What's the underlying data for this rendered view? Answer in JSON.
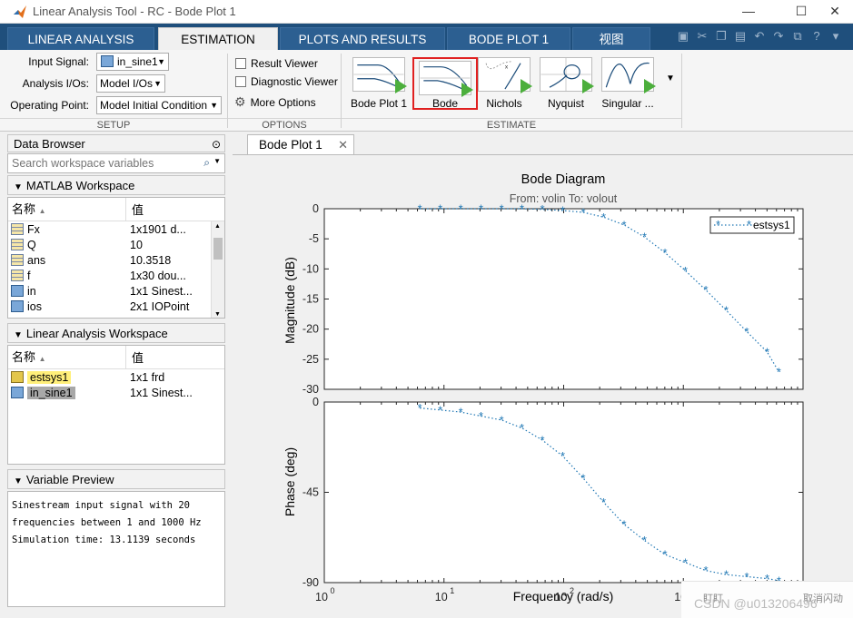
{
  "window": {
    "title": "Linear Analysis Tool - RC - Bode Plot 1"
  },
  "ribbon_tabs": [
    "LINEAR ANALYSIS",
    "ESTIMATION",
    "PLOTS AND RESULTS",
    "BODE PLOT 1",
    "视图"
  ],
  "setup": {
    "input_signal_label": "Input Signal:",
    "input_signal_value": "in_sine1",
    "analysis_ios_label": "Analysis I/Os:",
    "analysis_ios_value": "Model I/Os",
    "operating_point_label": "Operating Point:",
    "operating_point_value": "Model Initial Condition",
    "section": "SETUP"
  },
  "options": {
    "result_viewer": "Result Viewer",
    "diagnostic_viewer": "Diagnostic Viewer",
    "more_options": "More Options",
    "section": "OPTIONS"
  },
  "estimate": {
    "buttons": [
      "Bode Plot 1",
      "Bode",
      "Nichols",
      "Nyquist",
      "Singular ..."
    ],
    "section": "ESTIMATE"
  },
  "data_browser": {
    "title": "Data Browser",
    "search_placeholder": "Search workspace variables",
    "matlab_workspace_title": "MATLAB Workspace",
    "col_name": "名称",
    "col_value": "值",
    "matlab_rows": [
      {
        "name": "Fx",
        "value": "1x1901 d...",
        "icon": "matrix-icon"
      },
      {
        "name": "Q",
        "value": "10",
        "icon": "matrix-icon"
      },
      {
        "name": "ans",
        "value": "10.3518",
        "icon": "matrix-icon"
      },
      {
        "name": "f",
        "value": "1x30 dou...",
        "icon": "matrix-icon"
      },
      {
        "name": "in",
        "value": "1x1 Sinest...",
        "icon": "object-icon"
      },
      {
        "name": "ios",
        "value": "2x1 IOPoint",
        "icon": "object-icon"
      }
    ],
    "linear_workspace_title": "Linear Analysis Workspace",
    "linear_rows": [
      {
        "name": "estsys1",
        "value": "1x1 frd",
        "icon": "frd-icon"
      },
      {
        "name": "in_sine1",
        "value": "1x1 Sinest...",
        "icon": "object-icon"
      }
    ],
    "variable_preview_title": "Variable Preview",
    "variable_preview_lines": [
      "Sinestream input signal with 20",
      "frequencies between 1 and 1000 Hz",
      "Simulation time: 13.1139 seconds"
    ]
  },
  "document": {
    "tab": "Bode Plot 1"
  },
  "chart_data": {
    "type": "line",
    "title": "Bode Diagram",
    "subtitle": "From: volin  To: volout",
    "xlabel": "Frequency  (rad/s)",
    "x_scale": "log",
    "xlim": [
      1,
      10000
    ],
    "x_ticks": [
      "10",
      "10",
      "10",
      "10",
      "10"
    ],
    "x_tick_exponents": [
      "0",
      "1",
      "2",
      "3",
      "4"
    ],
    "magnitude": {
      "ylabel": "Magnitude (dB)",
      "ylim": [
        -30,
        0
      ],
      "y_ticks": [
        "0",
        "-5",
        "-10",
        "-15",
        "-20",
        "-25",
        "-30"
      ]
    },
    "phase": {
      "ylabel": "Phase (deg)",
      "ylim": [
        -90,
        0
      ],
      "y_ticks": [
        "0",
        "-45",
        "-90"
      ]
    },
    "legend": {
      "label": "estsys1",
      "position": "top-right"
    },
    "series": [
      {
        "name": "estsys1",
        "color": "#1f77b4",
        "x": [
          6.28,
          9.3,
          13.8,
          20.4,
          30.3,
          44.8,
          66.4,
          98.4,
          145.8,
          216,
          320,
          474,
          702,
          1040,
          1541,
          2283,
          3383,
          5013,
          6283
        ],
        "magnitude_db": [
          0.0,
          0.0,
          0.0,
          0.0,
          0.0,
          0.0,
          -0.1,
          -0.3,
          -0.6,
          -1.4,
          -2.7,
          -4.7,
          -7.3,
          -10.3,
          -13.5,
          -16.9,
          -20.4,
          -23.8,
          -27.1
        ],
        "phase_deg": [
          -3,
          -4,
          -5,
          -7,
          -9,
          -13,
          -19,
          -27,
          -38,
          -50,
          -61,
          -69,
          -76,
          -80,
          -84,
          -86,
          -87,
          -88,
          -89
        ]
      }
    ]
  },
  "notification": {
    "left": "盯盯",
    "right": "取消闪动",
    "watermark": "CSDN @u013206496"
  }
}
